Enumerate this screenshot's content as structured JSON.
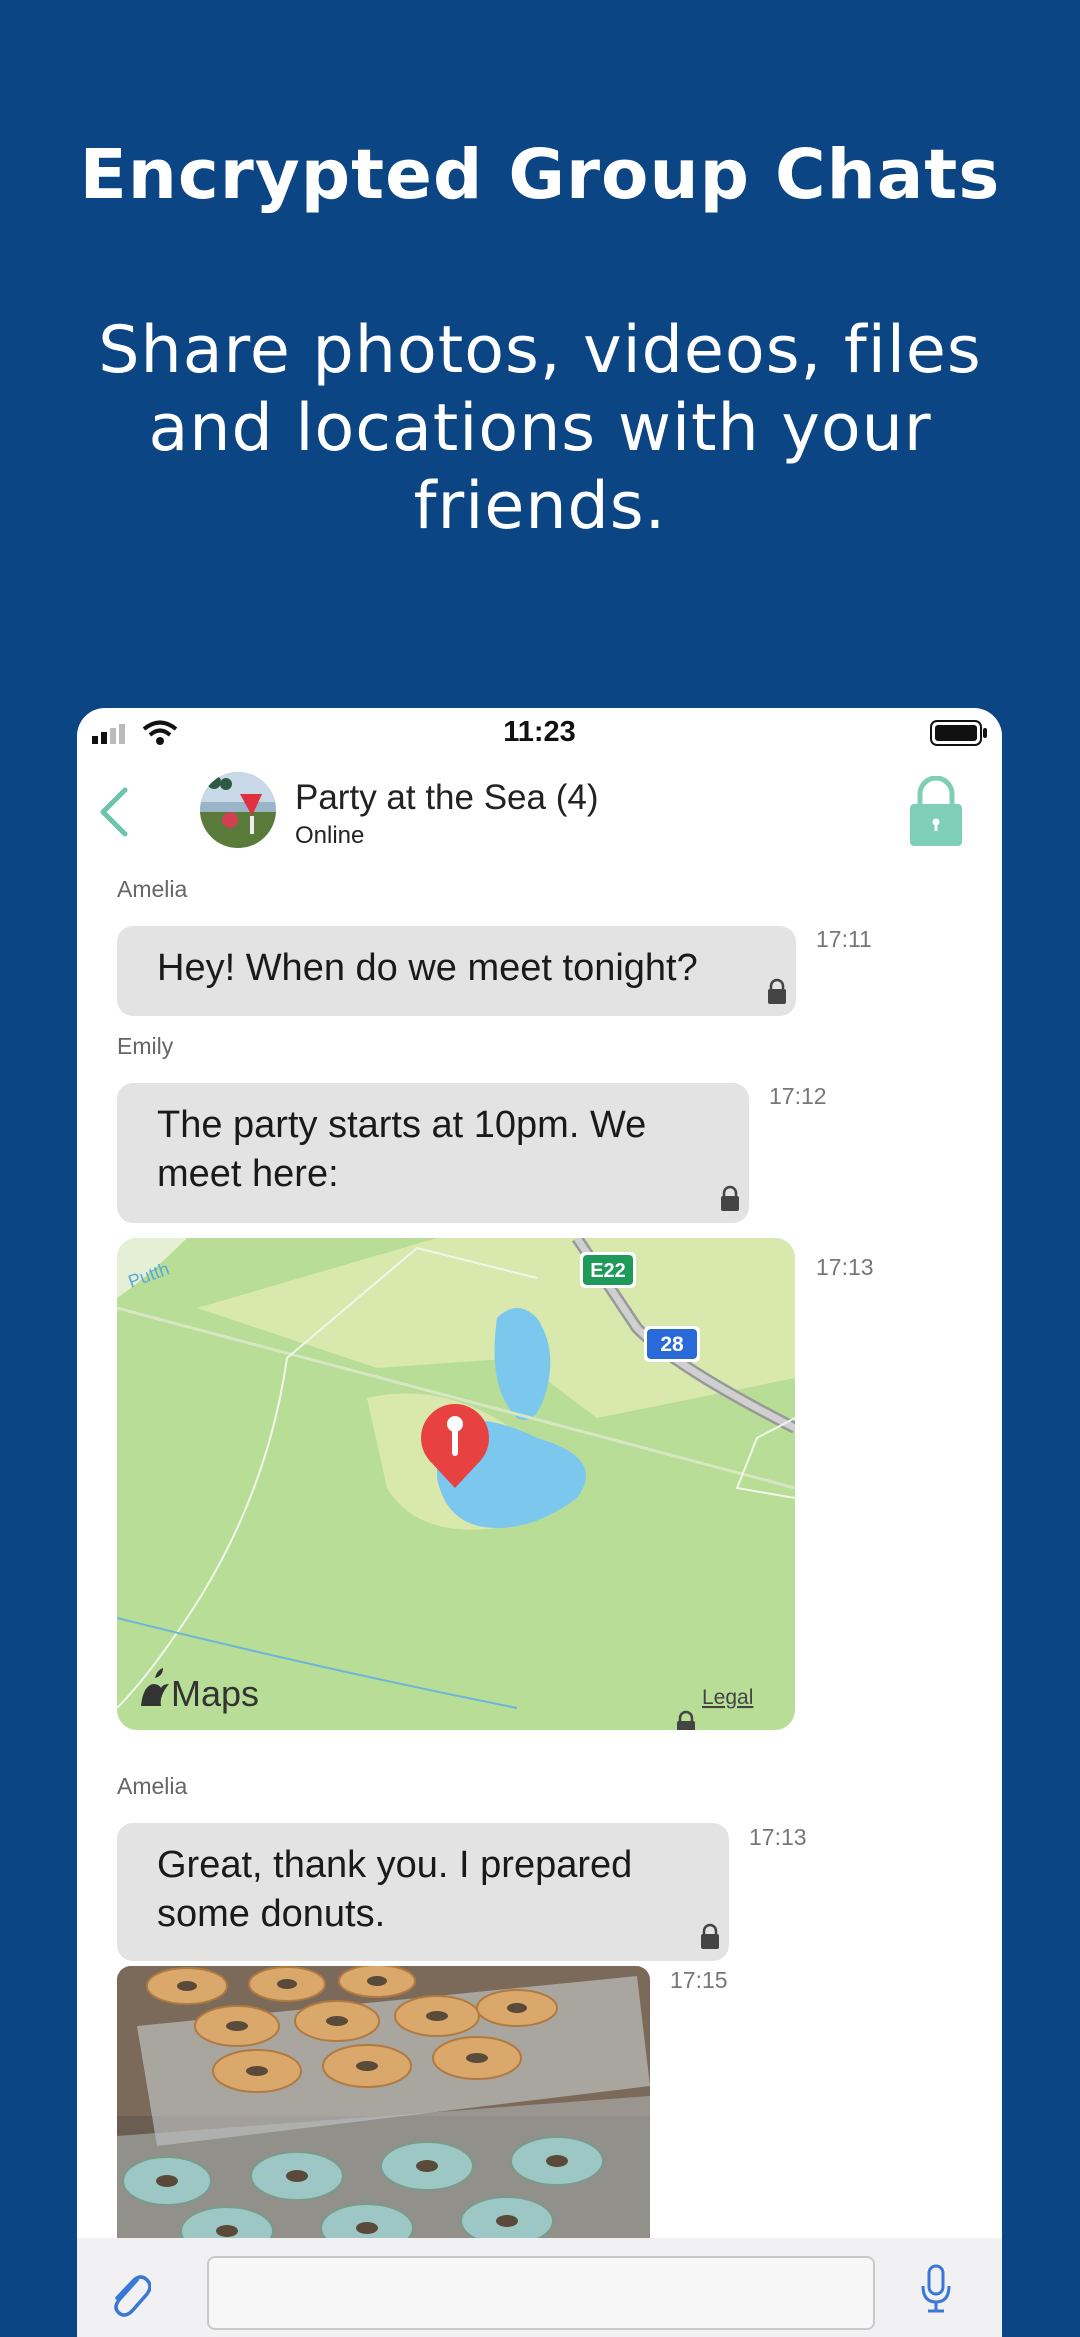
{
  "promo": {
    "title": "Encrypted Group Chats",
    "subtitle": "Share photos, videos, files and locations with your friends."
  },
  "status_bar": {
    "time": "11:23"
  },
  "chat_header": {
    "title": "Party at the Sea (4)",
    "status": "Online"
  },
  "messages": [
    {
      "sender": "Amelia",
      "text": "Hey! When do we meet tonight?",
      "time": "17:11"
    },
    {
      "sender": "Emily",
      "text": "The party starts at 10pm. We meet here:",
      "time": "17:12"
    },
    {
      "type": "location",
      "time": "17:13",
      "map_brand": "Maps",
      "legal_link": "Legal",
      "road_labels": [
        "E22",
        "28"
      ],
      "place_label": "Putth"
    },
    {
      "sender": "Amelia",
      "text": "Great, thank you. I prepared some donuts.",
      "time": "17:13"
    },
    {
      "type": "image",
      "time": "17:15",
      "subject": "donuts"
    }
  ],
  "colors": {
    "background": "#0b4584",
    "accent": "#7fcfb7",
    "bubble": "#e3e3e3",
    "pin": "#e84141"
  },
  "icons": [
    "back-chevron-icon",
    "lock-icon",
    "paperclip-icon",
    "microphone-icon",
    "signal-icon",
    "wifi-icon",
    "battery-icon"
  ]
}
